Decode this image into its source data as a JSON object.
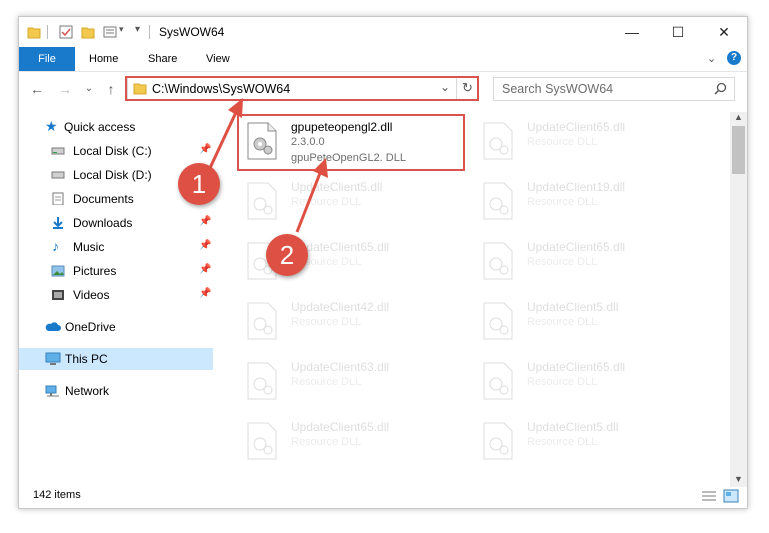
{
  "window": {
    "title": "SysWOW64"
  },
  "ribbon": {
    "file": "File",
    "home": "Home",
    "share": "Share",
    "view": "View"
  },
  "address": {
    "path": "C:\\Windows\\SysWOW64"
  },
  "search": {
    "placeholder": "Search SysWOW64"
  },
  "sidebar": {
    "items": [
      {
        "label": "Quick access",
        "icon": "star-icon"
      },
      {
        "label": "Local Disk (C:)",
        "icon": "drive-icon",
        "pinned": true
      },
      {
        "label": "Local Disk (D:)",
        "icon": "drive-icon",
        "pinned": true
      },
      {
        "label": "Documents",
        "icon": "documents-icon",
        "pinned": true
      },
      {
        "label": "Downloads",
        "icon": "downloads-icon",
        "pinned": true
      },
      {
        "label": "Music",
        "icon": "music-icon",
        "pinned": true
      },
      {
        "label": "Pictures",
        "icon": "pictures-icon",
        "pinned": true
      },
      {
        "label": "Videos",
        "icon": "videos-icon",
        "pinned": true
      },
      {
        "label": "OneDrive",
        "icon": "cloud-icon"
      },
      {
        "label": "This PC",
        "icon": "pc-icon",
        "selected": true
      },
      {
        "label": "Network",
        "icon": "network-icon"
      }
    ]
  },
  "files": {
    "highlighted": {
      "name": "gpupeteopengl2.dll",
      "version": "2.3.0.0",
      "description": "gpuPeteOpenGL2. DLL"
    },
    "faded": [
      {
        "name": "UpdateClient65.dll",
        "type": "Resource DLL"
      },
      {
        "name": "UpdateClient5.dll",
        "type": "Resource DLL"
      },
      {
        "name": "UpdateClient19.dll",
        "type": "Resource DLL"
      },
      {
        "name": "UpdateClient65.dll",
        "type": "Resource DLL"
      },
      {
        "name": "UpdateClient65.dll",
        "type": "Resource DLL"
      },
      {
        "name": "UpdateClient42.dll",
        "type": "Resource DLL"
      },
      {
        "name": "UpdateClient5.dll",
        "type": "Resource DLL"
      },
      {
        "name": "UpdateClient63.dll",
        "type": "Resource DLL"
      },
      {
        "name": "UpdateClient65.dll",
        "type": "Resource DLL"
      },
      {
        "name": "UpdateClient65.dll",
        "type": "Resource DLL"
      },
      {
        "name": "UpdateClient5.dll",
        "type": "Resource DLL"
      }
    ]
  },
  "status": {
    "count": "142 items"
  },
  "annotations": {
    "marker1": "1",
    "marker2": "2",
    "color": "#de5043"
  },
  "colors": {
    "accent": "#1979ca",
    "selection": "#cce8ff"
  }
}
